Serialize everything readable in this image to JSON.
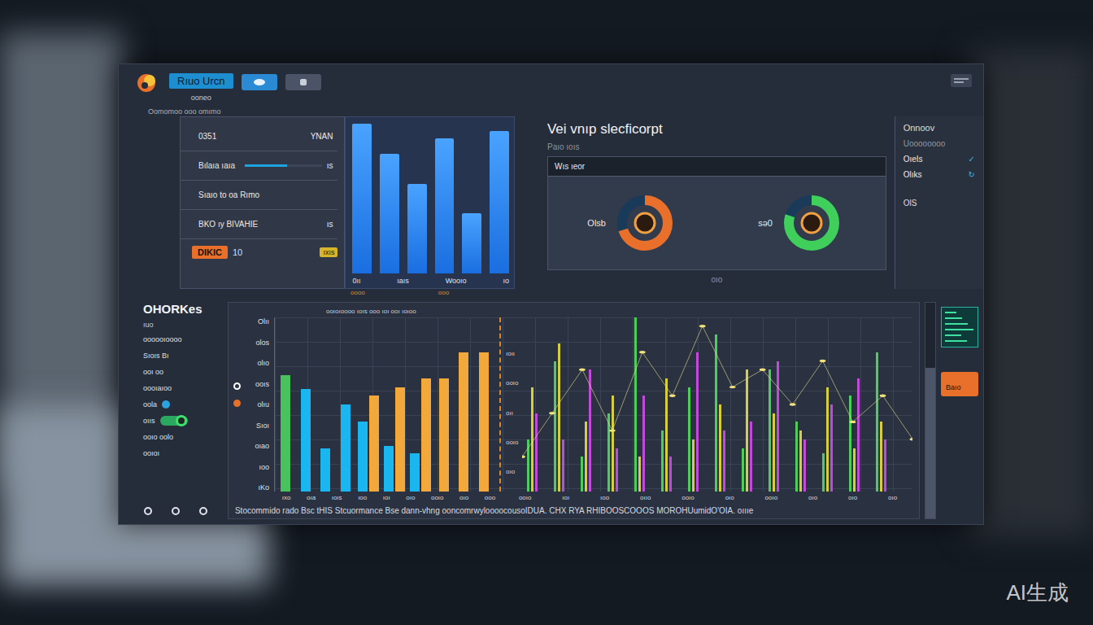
{
  "header": {
    "button": "Rıuo Urcn",
    "subtitle": "ooneo",
    "caption": "Oomomoo ooo omımo"
  },
  "list_panel": {
    "rows": [
      {
        "kind": "text",
        "label": "0351",
        "reading": "YNAN"
      },
      {
        "kind": "meter",
        "label": "Bılaıa ıaıa",
        "reading": "ıs",
        "level": 0.55
      },
      {
        "kind": "text",
        "label": "Sıaıo to oa Rımo"
      },
      {
        "kind": "text",
        "label": "BKO ıy BIVAHIE",
        "reading": "ıs"
      }
    ],
    "badge": "DIKIC",
    "badge_count": "10",
    "tag": "ıxıs"
  },
  "mini_chart": {
    "values": [
      100,
      80,
      60,
      90,
      40,
      95
    ],
    "x_labels": [
      "0ıı",
      "ıaıs",
      "Wooıo",
      "ıo"
    ],
    "captions": [
      "oooo",
      "ooo"
    ]
  },
  "overview": {
    "title": "Vei vnıp slecficorpt",
    "subtitle": "Paıo ıoıs",
    "strip_label": "Wıs  ıeor",
    "gauges": [
      {
        "label": "Olsb",
        "level": 0.7,
        "color": "#e8702a"
      },
      {
        "label": "sǝ0",
        "level": 0.8,
        "color": "#3fcf5a"
      }
    ],
    "footer": "oıo"
  },
  "sidebar": {
    "title": "Onnoov",
    "subtitle": "Uoooooooo",
    "items": [
      {
        "label": "OıeIs",
        "icon": "✓"
      },
      {
        "label": "Olıks",
        "icon": "↻"
      }
    ],
    "footer": "OlS"
  },
  "bottom_panel": {
    "title": "OHORKes",
    "subtitle": "ıuo",
    "items": [
      {
        "kind": "text",
        "label": "oooooıoooo"
      },
      {
        "kind": "text",
        "label": "Sıoıs Bı"
      },
      {
        "kind": "text",
        "label": "ooı oo"
      },
      {
        "kind": "text",
        "label": "oooıaıoo"
      },
      {
        "kind": "dot",
        "label": "oola",
        "color": "#2aa3e0"
      },
      {
        "kind": "toggle",
        "label": "oııs",
        "on": true
      },
      {
        "kind": "text",
        "label": "ooıo oolo"
      },
      {
        "kind": "text",
        "label": "ooıoı"
      }
    ]
  },
  "main_chart": {
    "caption": "ooıoıoooo ıoıs ooo ıoı ooı ıoıoo",
    "y_ticks": [
      "Olıı",
      "olos",
      "olıo",
      "ooıs",
      "olıu",
      "Sıoı",
      "oıao",
      "ıoo",
      "ıKo"
    ],
    "inner_ticks": [
      "ıoıı",
      "ooıo",
      "oıı",
      "ooıo",
      "oıo"
    ],
    "legend": [
      {
        "color": "#ffffff"
      },
      {
        "color": "#e8702a"
      }
    ],
    "bar_series": [
      {
        "color": "#49c15d",
        "values": [
          67,
          0,
          0,
          0,
          0,
          0,
          0,
          0,
          0,
          0
        ]
      },
      {
        "color": "#19b6f0",
        "values": [
          0,
          59,
          25,
          50,
          40,
          26,
          22,
          0,
          0,
          0
        ]
      },
      {
        "color": "#f2a83a",
        "values": [
          0,
          0,
          0,
          0,
          55,
          60,
          65,
          65,
          80,
          80
        ]
      }
    ],
    "spike_series": [
      {
        "color": "#4ccf5a",
        "values": [
          30,
          75,
          20,
          45,
          100,
          35,
          60,
          90,
          25,
          70,
          40,
          22,
          55,
          80
        ]
      },
      {
        "color": "#d6cf3a",
        "values": [
          60,
          85,
          40,
          55,
          20,
          65,
          30,
          50,
          70,
          45,
          35,
          60,
          25,
          40
        ]
      },
      {
        "color": "#c24ad8",
        "values": [
          45,
          30,
          70,
          25,
          55,
          20,
          80,
          35,
          40,
          75,
          30,
          50,
          65,
          30
        ]
      }
    ],
    "line": [
      20,
      45,
      70,
      35,
      80,
      55,
      95,
      60,
      70,
      50,
      75,
      40,
      55,
      30
    ],
    "x_left": [
      "ıxo",
      "oıa",
      "ıoıs",
      "ıoo",
      "ıoı",
      "oıo",
      "ooıo",
      "oıo",
      "ooo"
    ],
    "x_right": [
      "ooıo",
      "ıoı",
      "ıoo",
      "oııo",
      "ooıo",
      "oıo",
      "ooıo",
      "oıo",
      "oıo",
      "oıo"
    ]
  },
  "footer": "Stocommido rado Bsc tHIS Stcuormance Bse dann-vhng ooncomrwyloooocousoIDUA. CHX RYA RHIBOOSCOOOS MOROHUumidO'OIA. oıııe",
  "right_strip": {
    "button": "Baıo",
    "scroll_level": 0.7
  },
  "watermark": "AI生成"
}
